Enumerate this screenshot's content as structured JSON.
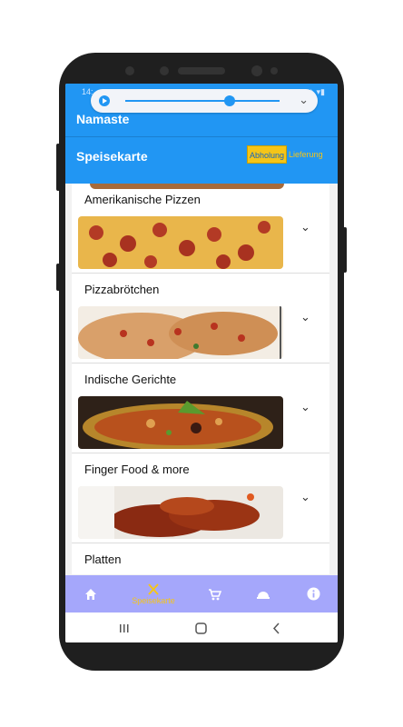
{
  "app": {
    "title": "Namaste"
  },
  "status_bar": {
    "time": "14:..",
    "icons_left": "⊙ ◷ ⊡",
    "icons_right": "∗ ◈ ▾▮"
  },
  "header": {
    "title": "Speisekarte"
  },
  "toggle": {
    "options": [
      "Abholung",
      "Lieferung"
    ],
    "selected": "Abholung"
  },
  "menu_items": [
    {
      "title": "Amerikanische Pizzen",
      "image": "pepperoni-pizza"
    },
    {
      "title": "Pizzabrötchen",
      "image": "pizza-bread"
    },
    {
      "title": "Indische Gerichte",
      "image": "indian-curry"
    },
    {
      "title": "Finger Food & more",
      "image": "chicken-wings"
    },
    {
      "title": "Platten",
      "image": "platter"
    }
  ],
  "bottom_nav": [
    {
      "icon": "home-icon",
      "label": ""
    },
    {
      "icon": "cutlery-icon",
      "label": "Speisekarte",
      "active": true
    },
    {
      "icon": "cart-icon",
      "label": ""
    },
    {
      "icon": "cloche-icon",
      "label": ""
    },
    {
      "icon": "info-icon",
      "label": ""
    }
  ],
  "colors": {
    "primary": "#2196f3",
    "accent": "#f5c518",
    "bottom_nav": "#a5a7fb"
  }
}
